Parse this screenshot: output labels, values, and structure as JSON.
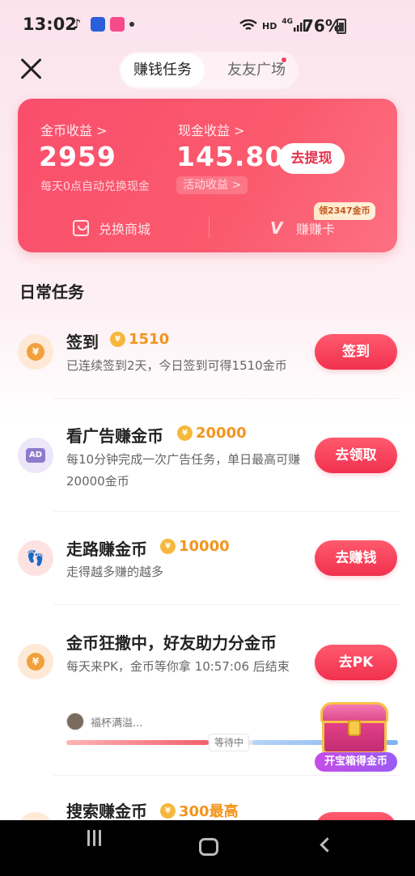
{
  "status_bar": {
    "time": "13:02",
    "network_label": "HD",
    "cell_label": "4G",
    "battery": "76%"
  },
  "header": {
    "tabs": [
      {
        "label": "赚钱任务",
        "active": true
      },
      {
        "label": "友友广场",
        "active": false
      }
    ]
  },
  "earnings": {
    "coin_title": "金币收益 >",
    "coin_value": "2959",
    "coin_note": "每天0点自动兑换现金",
    "cash_title": "现金收益 >",
    "cash_value": "145.80",
    "activity_label": "活动收益 >",
    "withdraw_label": "去提现",
    "shop_label": "兑换商城",
    "card_label": "赚赚卡",
    "card_badge": "领2347金币"
  },
  "section": {
    "title": "日常任务"
  },
  "tasks": [
    {
      "title": "签到",
      "reward": "1510",
      "desc": "已连续签到2天，今日签到可得1510金币",
      "button": "签到",
      "icon": "coin-icon"
    },
    {
      "title": "看广告赚金币",
      "reward": "20000",
      "desc": "每10分钟完成一次广告任务，单日最高可赚20000金币",
      "button": "去领取",
      "icon": "ad-icon",
      "icon_text": "AD"
    },
    {
      "title": "走路赚金币",
      "reward": "10000",
      "desc": "走得越多赚的越多",
      "button": "去赚钱",
      "icon": "footsteps-icon"
    },
    {
      "title": "金币狂撒中，好友助力分金币",
      "reward": "",
      "desc": "每天来PK，金币等你拿 10:57:06 后结束",
      "button": "去PK",
      "icon": "coin-icon",
      "helper_name": "福杯满溢...",
      "progress_label": "等待中"
    },
    {
      "title": "搜索赚金币",
      "reward": "300最高",
      "desc": "",
      "button": "",
      "icon": "coin-icon"
    }
  ],
  "treasure": {
    "label": "开宝箱得金币",
    "icon": "treasure-chest-icon"
  },
  "colors": {
    "accent": "#f23d5c",
    "coin": "#f2951d",
    "card_start": "#f94e6d",
    "card_end": "#fc7083"
  }
}
